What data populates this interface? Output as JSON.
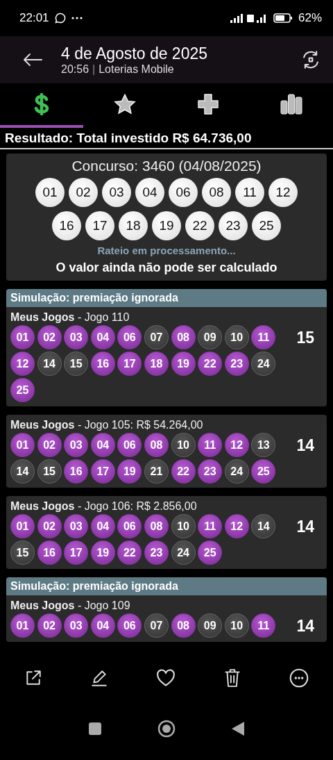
{
  "status_bar": {
    "time": "22:01",
    "battery": "62%"
  },
  "header": {
    "title": "4 de Agosto de 2025",
    "time": "20:56",
    "separator": "|",
    "app": "Loterias Mobile"
  },
  "tabs": [
    {
      "kind": "money",
      "selected": true
    },
    {
      "kind": "star",
      "selected": false
    },
    {
      "kind": "plus",
      "selected": false
    },
    {
      "kind": "chart",
      "selected": false
    }
  ],
  "summary": "Resultado: Total investido R$ 64.736,00",
  "draw": {
    "title": "Concurso: 3460 (04/08/2025)",
    "numbers": [
      "01",
      "02",
      "03",
      "04",
      "06",
      "08",
      "11",
      "12",
      "16",
      "17",
      "18",
      "19",
      "22",
      "23",
      "25"
    ],
    "status": "Rateio em processamento...",
    "note": "O valor ainda não pode ser calculado"
  },
  "games": [
    {
      "banner": "Simulação: premiação ignorada",
      "title": "**Meus Jogos** - Jogo 110",
      "score": "15",
      "balls": [
        {
          "n": "01",
          "hit": true
        },
        {
          "n": "02",
          "hit": true
        },
        {
          "n": "03",
          "hit": true
        },
        {
          "n": "04",
          "hit": true
        },
        {
          "n": "06",
          "hit": true
        },
        {
          "n": "07",
          "hit": false
        },
        {
          "n": "08",
          "hit": true
        },
        {
          "n": "09",
          "hit": false
        },
        {
          "n": "10",
          "hit": false
        },
        {
          "n": "11",
          "hit": true
        },
        {
          "n": "12",
          "hit": true
        },
        {
          "n": "14",
          "hit": false
        },
        {
          "n": "15",
          "hit": false
        },
        {
          "n": "16",
          "hit": true
        },
        {
          "n": "17",
          "hit": true
        },
        {
          "n": "18",
          "hit": true
        },
        {
          "n": "19",
          "hit": true
        },
        {
          "n": "22",
          "hit": true
        },
        {
          "n": "23",
          "hit": true
        },
        {
          "n": "24",
          "hit": false
        },
        {
          "n": "25",
          "hit": true
        }
      ]
    },
    {
      "title": "**Meus Jogos** - Jogo 105: R$ 54.264,00",
      "score": "14",
      "balls": [
        {
          "n": "01",
          "hit": true
        },
        {
          "n": "02",
          "hit": true
        },
        {
          "n": "03",
          "hit": true
        },
        {
          "n": "04",
          "hit": true
        },
        {
          "n": "06",
          "hit": true
        },
        {
          "n": "08",
          "hit": true
        },
        {
          "n": "10",
          "hit": false
        },
        {
          "n": "11",
          "hit": true
        },
        {
          "n": "12",
          "hit": true
        },
        {
          "n": "13",
          "hit": false
        },
        {
          "n": "14",
          "hit": false
        },
        {
          "n": "15",
          "hit": false
        },
        {
          "n": "16",
          "hit": true
        },
        {
          "n": "17",
          "hit": true
        },
        {
          "n": "19",
          "hit": true
        },
        {
          "n": "21",
          "hit": false
        },
        {
          "n": "22",
          "hit": true
        },
        {
          "n": "23",
          "hit": true
        },
        {
          "n": "24",
          "hit": false
        },
        {
          "n": "25",
          "hit": true
        }
      ]
    },
    {
      "title": "**Meus Jogos** - Jogo 106: R$ 2.856,00",
      "score": "14",
      "balls": [
        {
          "n": "01",
          "hit": true
        },
        {
          "n": "02",
          "hit": true
        },
        {
          "n": "03",
          "hit": true
        },
        {
          "n": "04",
          "hit": true
        },
        {
          "n": "06",
          "hit": true
        },
        {
          "n": "08",
          "hit": true
        },
        {
          "n": "10",
          "hit": false
        },
        {
          "n": "11",
          "hit": true
        },
        {
          "n": "12",
          "hit": true
        },
        {
          "n": "14",
          "hit": false
        },
        {
          "n": "15",
          "hit": false
        },
        {
          "n": "16",
          "hit": true
        },
        {
          "n": "17",
          "hit": true
        },
        {
          "n": "19",
          "hit": true
        },
        {
          "n": "22",
          "hit": true
        },
        {
          "n": "23",
          "hit": true
        },
        {
          "n": "24",
          "hit": false
        },
        {
          "n": "25",
          "hit": true
        }
      ]
    },
    {
      "banner": "Simulação: premiação ignorada",
      "title": "**Meus Jogos** - Jogo 109",
      "score": "14",
      "balls": [
        {
          "n": "01",
          "hit": true
        },
        {
          "n": "02",
          "hit": true
        },
        {
          "n": "03",
          "hit": true
        },
        {
          "n": "04",
          "hit": true
        },
        {
          "n": "06",
          "hit": true
        },
        {
          "n": "07",
          "hit": false
        },
        {
          "n": "08",
          "hit": true
        },
        {
          "n": "09",
          "hit": false
        },
        {
          "n": "10",
          "hit": false
        },
        {
          "n": "11",
          "hit": true
        }
      ]
    }
  ],
  "actions": [
    {
      "kind": "share"
    },
    {
      "kind": "edit"
    },
    {
      "kind": "favorite"
    },
    {
      "kind": "delete"
    },
    {
      "kind": "more"
    }
  ]
}
